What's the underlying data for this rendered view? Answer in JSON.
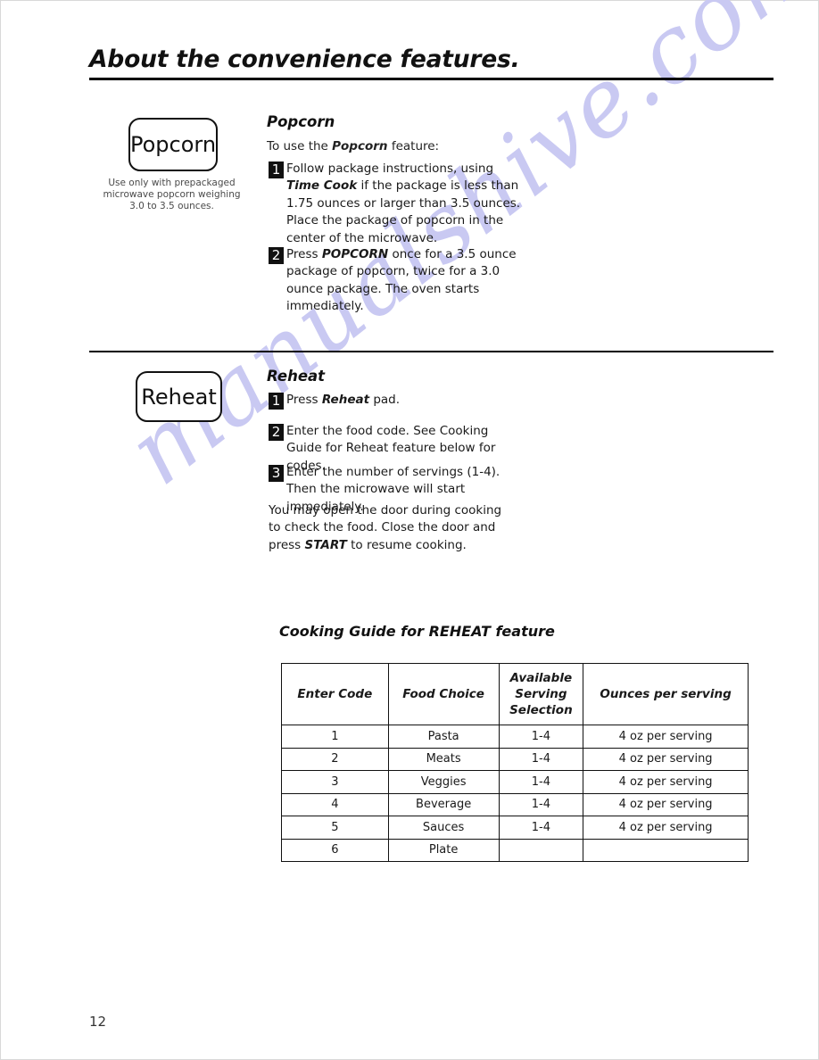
{
  "document": {
    "page_number": "12",
    "title": "About the convenience features.",
    "watermark": "manualshive.com",
    "watermark_color": "#c9c9f2"
  },
  "popcorn": {
    "pad_label": "Popcorn",
    "pad_caption": "Use only with prepackaged microwave popcorn weighing 3.0 to 3.5 ounces.",
    "heading": "Popcorn",
    "intro_prefix": "To use the ",
    "intro_emphasis": "Popcorn",
    "intro_suffix": " feature:",
    "steps": [
      {
        "number": "1",
        "parts": [
          {
            "text": "Follow package instructions, using ",
            "style": "normal"
          },
          {
            "text": "Time Cook",
            "style": "bold-italic"
          },
          {
            "text": " if the package is less than 1.75 ounces or larger than 3.5 ounces. Place the package of popcorn in the center of the microwave.",
            "style": "normal"
          }
        ]
      },
      {
        "number": "2",
        "parts": [
          {
            "text": "Press ",
            "style": "normal"
          },
          {
            "text": "POPCORN",
            "style": "bold-italic"
          },
          {
            "text": " once for a 3.5 ounce package of popcorn, twice for a 3.0 ounce package. The oven starts immediately.",
            "style": "normal"
          }
        ]
      }
    ]
  },
  "reheat": {
    "pad_label": "Reheat",
    "heading": "Reheat",
    "steps": [
      {
        "number": "1",
        "parts": [
          {
            "text": "Press ",
            "style": "normal"
          },
          {
            "text": "Reheat",
            "style": "bold-italic"
          },
          {
            "text": " pad.",
            "style": "normal"
          }
        ]
      },
      {
        "number": "2",
        "parts": [
          {
            "text": "Enter the food code.  See Cooking Guide for Reheat feature below for codes.",
            "style": "normal"
          }
        ]
      },
      {
        "number": "3",
        "parts": [
          {
            "text": "Enter the number of servings (1-4).  Then the microwave will start immediately.",
            "style": "normal"
          }
        ]
      }
    ],
    "note_parts": [
      {
        "text": "You may open the door during cooking to check the food. Close the door and press ",
        "style": "normal"
      },
      {
        "text": "START",
        "style": "bold-italic"
      },
      {
        "text": " to resume cooking.",
        "style": "normal"
      }
    ]
  },
  "cooking_guide": {
    "title": "Cooking Guide for REHEAT feature",
    "columns": [
      "Enter Code",
      "Food Choice",
      "Available Serving Selection",
      "Ounces per serving"
    ],
    "rows": [
      {
        "code": "1",
        "food": "Pasta",
        "serving": "1-4",
        "ounces": "4 oz per serving"
      },
      {
        "code": "2",
        "food": "Meats",
        "serving": "1-4",
        "ounces": "4 oz per serving"
      },
      {
        "code": "3",
        "food": "Veggies",
        "serving": "1-4",
        "ounces": "4 oz per serving"
      },
      {
        "code": "4",
        "food": "Beverage",
        "serving": "1-4",
        "ounces": "4 oz per serving"
      },
      {
        "code": "5",
        "food": "Sauces",
        "serving": "1-4",
        "ounces": "4 oz per serving"
      },
      {
        "code": "6",
        "food": "Plate",
        "serving": "",
        "ounces": ""
      }
    ]
  }
}
